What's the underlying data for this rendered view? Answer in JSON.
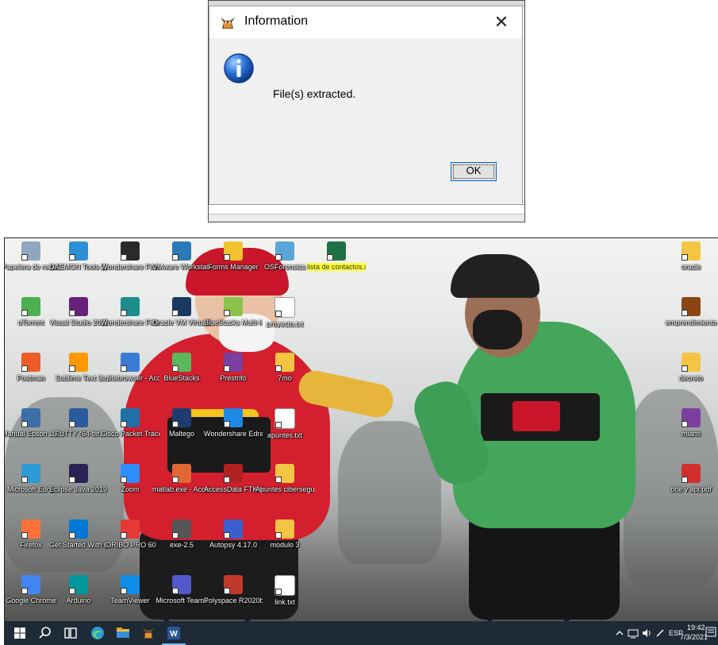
{
  "dialog": {
    "title": "Information",
    "message": "File(s) extracted.",
    "ok_label": "OK",
    "close_glyph": "✕",
    "background_text": "",
    "bottom_text": "",
    "icon": "info-icon",
    "app_icon": "app-cat-icon"
  },
  "desktop": {
    "icons_left": [
      {
        "label": "Papelera de reciclaje",
        "icon": "recycle-bin-icon",
        "color": "#8fa8c0"
      },
      {
        "label": "DAEMON Tools Lite",
        "icon": "daemon-tools-icon",
        "color": "#2d8fd5"
      },
      {
        "label": "Wondershare Filmora Scrn",
        "icon": "filmora-scrn-icon",
        "color": "#2a2a2a"
      },
      {
        "label": "VMware Workstation Pro",
        "icon": "vmware-icon",
        "color": "#2a7ab8"
      },
      {
        "label": "Forms Manager",
        "icon": "star-icon",
        "color": "#f2c230"
      },
      {
        "label": "OSForensics",
        "icon": "osforensics-icon",
        "color": "#5aa6d8"
      },
      {
        "label": "lista de contactos.xlsx",
        "icon": "excel-file-icon",
        "color": "#1e7145"
      },
      {
        "label": "uTorrent",
        "icon": "utorrent-icon",
        "color": "#4caf50"
      },
      {
        "label": "Visual Studio 2015",
        "icon": "visual-studio-icon",
        "color": "#68217a"
      },
      {
        "label": "Wondershare Filmora9",
        "icon": "filmora9-icon",
        "color": "#1f8c8c"
      },
      {
        "label": "Oracle VM VirtualBox",
        "icon": "virtualbox-icon",
        "color": "#183a61"
      },
      {
        "label": "BlueStacks Multi-Instan...",
        "icon": "bluestacks-multi-icon",
        "color": "#8bc34a"
      },
      {
        "label": "proyecto.txt",
        "icon": "text-file-icon",
        "color": "#ffffff"
      },
      {
        "label": "Postman",
        "icon": "postman-icon",
        "color": "#ef5b25"
      },
      {
        "label": "Sublime Text 3",
        "icon": "sublime-icon",
        "color": "#ff9800"
      },
      {
        "label": "sqlitebrowser - Acceso directo",
        "icon": "sqlite-icon",
        "color": "#3a7bd5"
      },
      {
        "label": "BlueStacks",
        "icon": "bluestacks-icon",
        "color": "#5cb85c"
      },
      {
        "label": "Prestrifo",
        "icon": "prestrifo-icon",
        "color": "#7b3fa0"
      },
      {
        "label": "7mo",
        "icon": "folder-icon",
        "color": "#f4c542"
      },
      {
        "label": "Manual Epson L3110",
        "icon": "manual-epson-icon",
        "color": "#3c6ea8"
      },
      {
        "label": "PuTTY (64-bit)",
        "icon": "putty-icon",
        "color": "#2c5aa0"
      },
      {
        "label": "Cisco Packet Tracer",
        "icon": "packet-tracer-icon",
        "color": "#1f6fa8"
      },
      {
        "label": "Maltego",
        "icon": "maltego-icon",
        "color": "#1e3c72"
      },
      {
        "label": "Wondershare EdrawMax",
        "icon": "edrawmax-icon",
        "color": "#1e88e5"
      },
      {
        "label": "apuntes.txt",
        "icon": "text-file-2-icon",
        "color": "#ffffff"
      },
      {
        "label": "Microsoft Edge",
        "icon": "edge-icon",
        "color": "#2c9ad6"
      },
      {
        "label": "Eclipse Java 2019-03",
        "icon": "eclipse-icon",
        "color": "#2c2255"
      },
      {
        "label": "Zoom",
        "icon": "zoom-icon",
        "color": "#2d8cff"
      },
      {
        "label": "matlab.exe - Acceso directo",
        "icon": "matlab-icon",
        "color": "#e16737"
      },
      {
        "label": "AccessData FTK Imager",
        "icon": "ftk-imager-icon",
        "color": "#b22222"
      },
      {
        "label": "Apuntes ciberseguridad",
        "icon": "folder-apuntes-icon",
        "color": "#f4c542"
      },
      {
        "label": "Firefox",
        "icon": "firefox-icon",
        "color": "#ff7139"
      },
      {
        "label": "Get Started With OneDrive...",
        "icon": "onedrive-icon",
        "color": "#0078d4"
      },
      {
        "label": "IDRIBO PRO 60",
        "icon": "idribo-icon",
        "color": "#e53935"
      },
      {
        "label": "exe-2.5",
        "icon": "exe-icon",
        "color": "#555555"
      },
      {
        "label": "Autopsy 4.17.0",
        "icon": "autopsy-icon",
        "color": "#3a5fcd"
      },
      {
        "label": "modulo 3",
        "icon": "folder-modulo-icon",
        "color": "#f4c542"
      },
      {
        "label": "Google Chrome",
        "icon": "chrome-icon",
        "color": "#4285f4"
      },
      {
        "label": "Arduino",
        "icon": "arduino-icon",
        "color": "#00979d"
      },
      {
        "label": "TeamViewer",
        "icon": "teamviewer-icon",
        "color": "#0e8ee9"
      },
      {
        "label": "Microsoft Teams",
        "icon": "teams-icon",
        "color": "#5059c9"
      },
      {
        "label": "Polyspace R2020b",
        "icon": "polyspace-icon",
        "color": "#c0392b"
      },
      {
        "label": "link.txt",
        "icon": "text-file-3-icon",
        "color": "#ffffff"
      }
    ],
    "icons_right": [
      {
        "label": "oracle",
        "icon": "oracle-folder-icon",
        "color": "#f4c542"
      },
      {
        "label": "emprendimiento",
        "icon": "emprendimiento-icon",
        "color": "#8b4513"
      },
      {
        "label": "decreto",
        "icon": "decreto-icon",
        "color": "#f4c542"
      },
      {
        "label": "miami",
        "icon": "miami-icon",
        "color": "#7b3fa0"
      },
      {
        "label": "one y api.pdf",
        "icon": "pdf-icon",
        "color": "#d32f2f"
      }
    ]
  },
  "taskbar": {
    "apps": [
      "windows-start-icon",
      "search-icon",
      "task-view-icon",
      "edge-taskbar-icon",
      "file-explorer-icon",
      "cat-app-icon",
      "word-icon"
    ],
    "tray": {
      "lang": "ESP",
      "time": "19:42",
      "date": "7/3/2021"
    }
  }
}
